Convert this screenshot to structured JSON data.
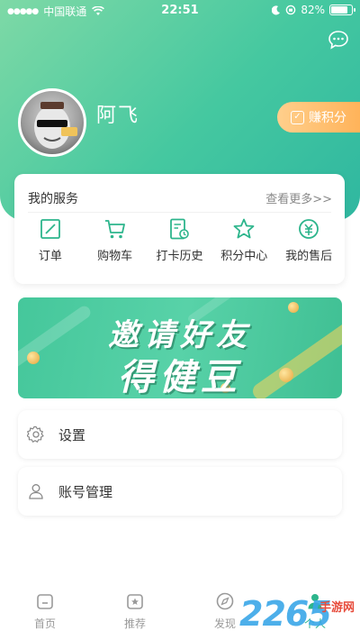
{
  "status_bar": {
    "carrier": "中国联通",
    "time": "22:51",
    "battery": "82%",
    "battery_level": 0.82
  },
  "profile": {
    "username": "阿飞",
    "earn_points_label": "赚积分"
  },
  "services": {
    "title": "我的服务",
    "more_label": "查看更多>>",
    "items": [
      {
        "label": "订单",
        "icon": "order-icon"
      },
      {
        "label": "购物车",
        "icon": "cart-icon"
      },
      {
        "label": "打卡历史",
        "icon": "checkin-history-icon"
      },
      {
        "label": "积分中心",
        "icon": "star-icon"
      },
      {
        "label": "我的售后",
        "icon": "after-sales-icon"
      }
    ]
  },
  "banner": {
    "line1": "邀请好友",
    "line2": "得健豆"
  },
  "menu": [
    {
      "label": "设置",
      "icon": "gear-icon"
    },
    {
      "label": "账号管理",
      "icon": "user-icon"
    }
  ],
  "tabbar": {
    "tabs": [
      {
        "label": "首页",
        "icon": "home-icon"
      },
      {
        "label": "推荐",
        "icon": "recommend-icon"
      },
      {
        "label": "发现",
        "icon": "compass-icon"
      },
      {
        "label": "个人",
        "icon": "person-icon"
      }
    ],
    "active_tab": "个人"
  },
  "watermark": {
    "number": "2265",
    "text": "手游网"
  },
  "colors": {
    "accent": "#2db58c",
    "header_gradient_start": "#7ed9a6",
    "header_gradient_end": "#2fb7a0",
    "earn_button": "#ffb35a"
  }
}
